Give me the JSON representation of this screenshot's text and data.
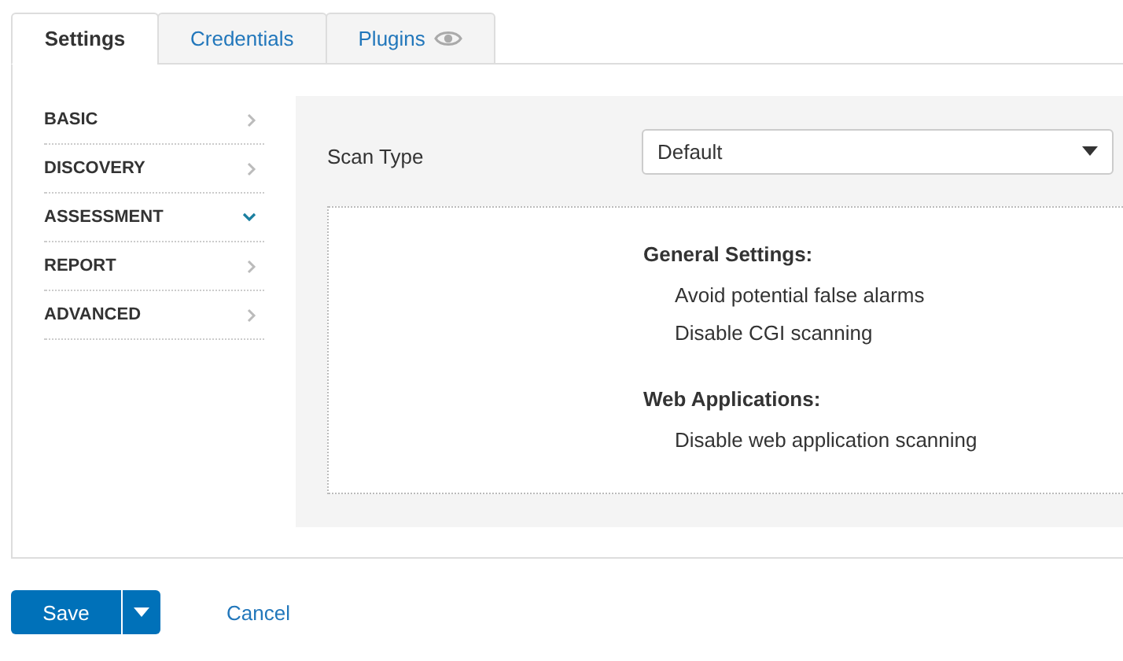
{
  "tabs": [
    {
      "label": "Settings",
      "selected": true,
      "icon": false
    },
    {
      "label": "Credentials",
      "selected": false,
      "icon": false
    },
    {
      "label": "Plugins",
      "selected": false,
      "icon": true
    }
  ],
  "sidebar": {
    "items": [
      {
        "label": "BASIC",
        "expanded": false
      },
      {
        "label": "DISCOVERY",
        "expanded": false
      },
      {
        "label": "ASSESSMENT",
        "expanded": true
      },
      {
        "label": "REPORT",
        "expanded": false
      },
      {
        "label": "ADVANCED",
        "expanded": false
      }
    ]
  },
  "scan_type": {
    "label": "Scan Type",
    "value": "Default"
  },
  "sections": [
    {
      "heading": "General Settings:",
      "items": [
        "Avoid potential false alarms",
        "Disable CGI scanning"
      ]
    },
    {
      "heading": "Web Applications:",
      "items": [
        "Disable web application scanning"
      ]
    }
  ],
  "buttons": {
    "save": "Save",
    "cancel": "Cancel"
  }
}
